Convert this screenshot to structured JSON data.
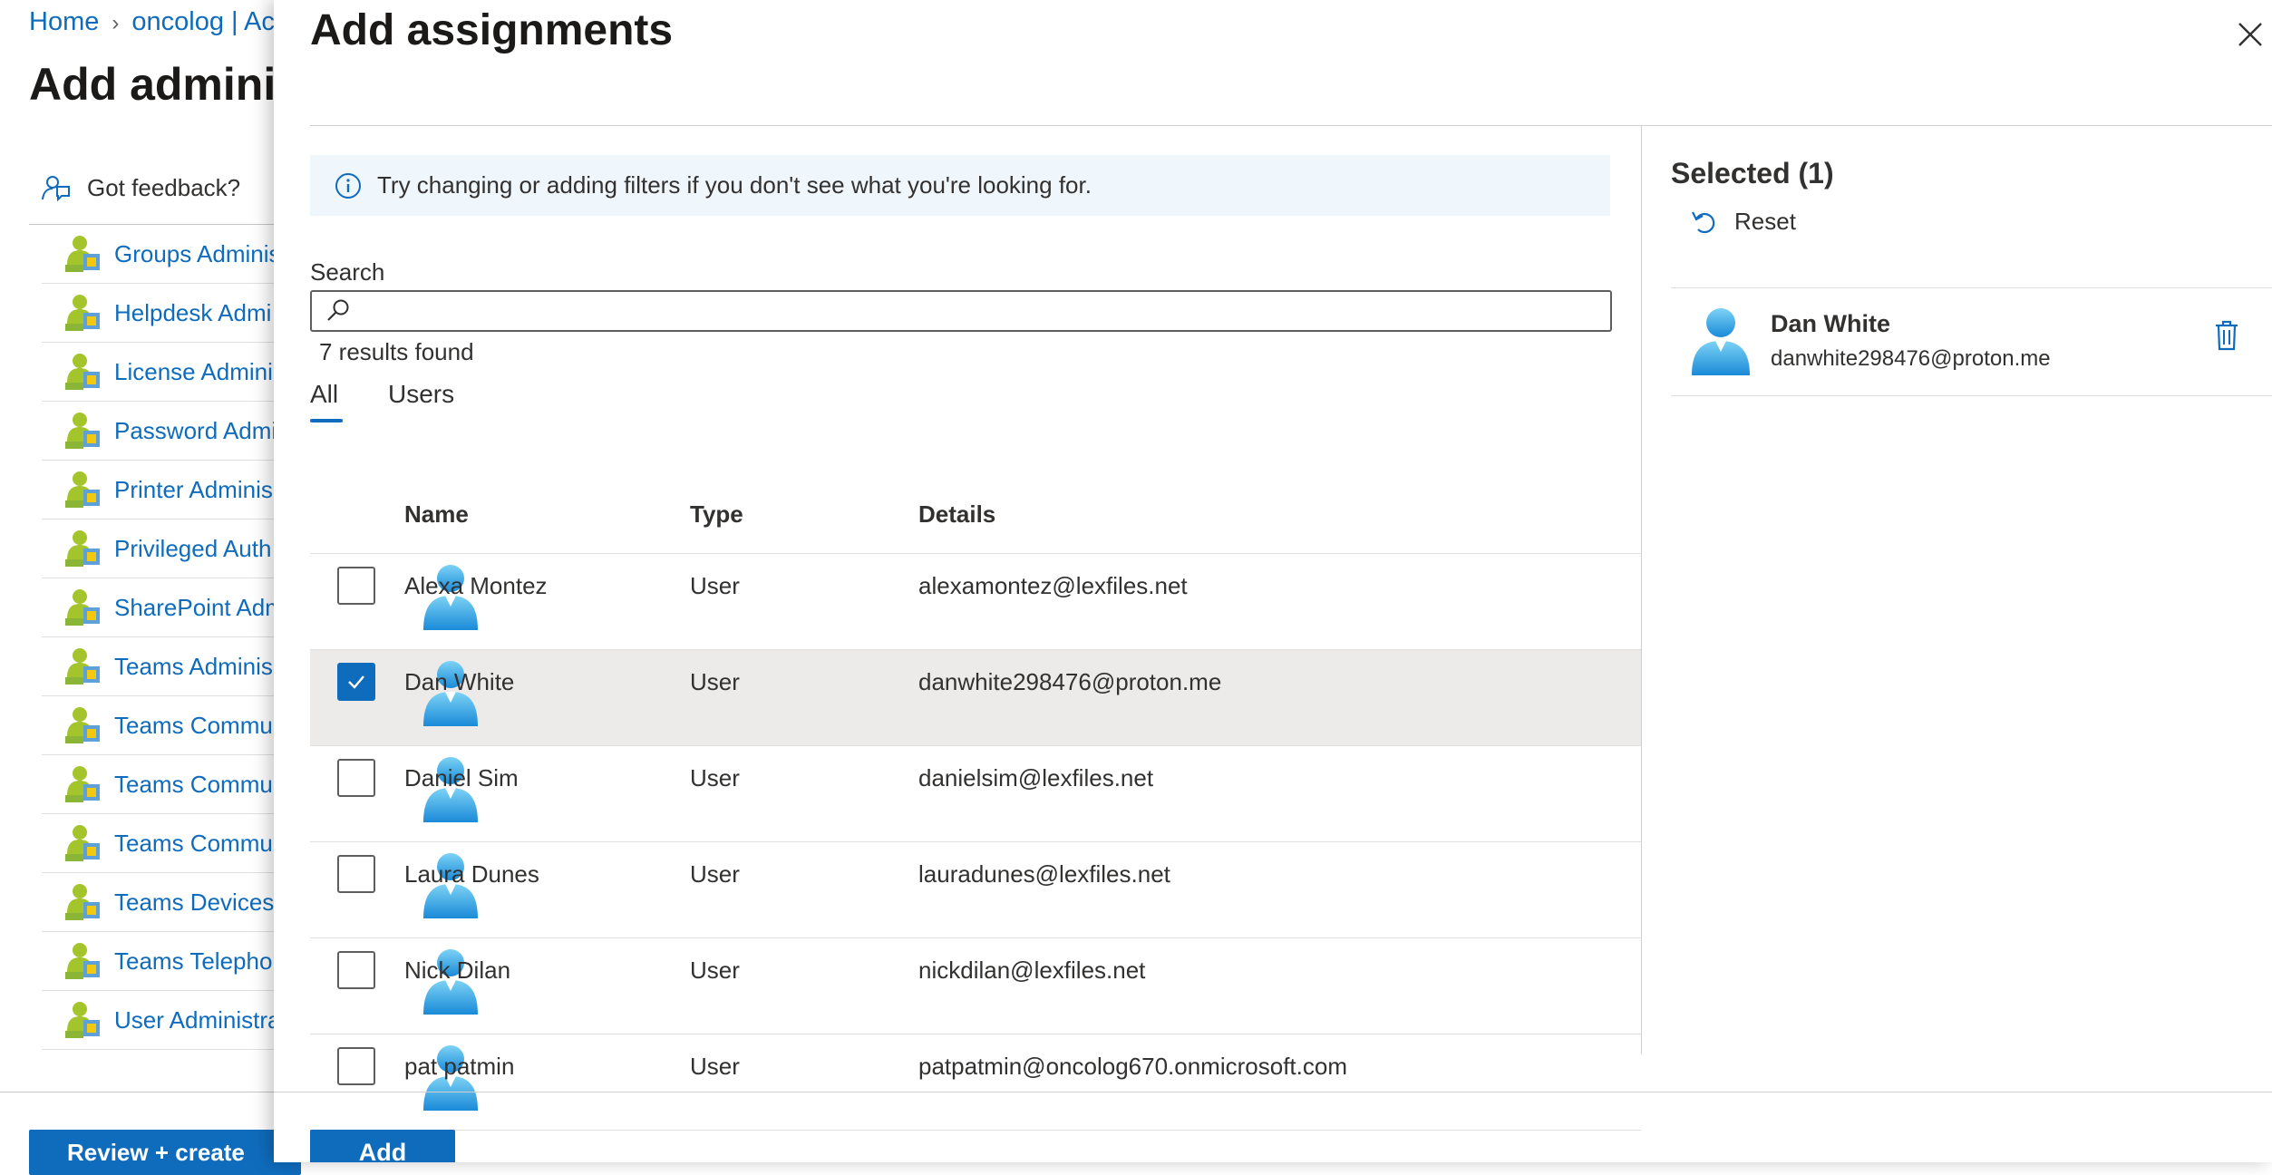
{
  "background": {
    "breadcrumb": [
      "Home",
      "oncolog | Ac"
    ],
    "title": "Add adminis",
    "feedback_label": "Got feedback?",
    "roles": [
      "Groups Adminis",
      "Helpdesk Admi",
      "License Admini",
      "Password Admi",
      "Printer Adminis",
      "Privileged Auth",
      "SharePoint Adm",
      "Teams Adminis",
      "Teams Commu",
      "Teams Commu",
      "Teams Commu",
      "Teams Devices",
      "Teams Telepho",
      "User Administra"
    ],
    "review_button": "Review + create"
  },
  "panel": {
    "title": "Add assignments",
    "info_text": "Try changing or adding filters if you don't see what you're looking for.",
    "search_label": "Search",
    "search_value": "",
    "results_text": "7 results found",
    "tabs": [
      "All",
      "Users"
    ],
    "active_tab": "All",
    "columns": {
      "name": "Name",
      "type": "Type",
      "details": "Details"
    },
    "rows": [
      {
        "name": "Alexa Montez",
        "type": "User",
        "details": "alexamontez@lexfiles.net",
        "checked": false
      },
      {
        "name": "Dan White",
        "type": "User",
        "details": "danwhite298476@proton.me",
        "checked": true
      },
      {
        "name": "Daniel Sim",
        "type": "User",
        "details": "danielsim@lexfiles.net",
        "checked": false
      },
      {
        "name": "Laura Dunes",
        "type": "User",
        "details": "lauradunes@lexfiles.net",
        "checked": false
      },
      {
        "name": "Nick Dilan",
        "type": "User",
        "details": "nickdilan@lexfiles.net",
        "checked": false
      },
      {
        "name": "pat patmin",
        "type": "User",
        "details": "patpatmin@oncolog670.onmicrosoft.com",
        "checked": false
      }
    ],
    "add_button": "Add"
  },
  "selected": {
    "title": "Selected (1)",
    "reset_label": "Reset",
    "items": [
      {
        "name": "Dan White",
        "detail": "danwhite298476@proton.me"
      }
    ]
  },
  "colors": {
    "accent": "#0f6cbd",
    "info_bg": "#eff6fc",
    "selected_row": "#edebe9"
  },
  "icons": {
    "info": "info-icon",
    "search": "search-icon",
    "close": "close-icon",
    "reset": "undo-icon",
    "delete": "trash-icon",
    "user": "user-avatar-icon",
    "role": "admin-role-icon",
    "feedback": "feedback-icon"
  }
}
